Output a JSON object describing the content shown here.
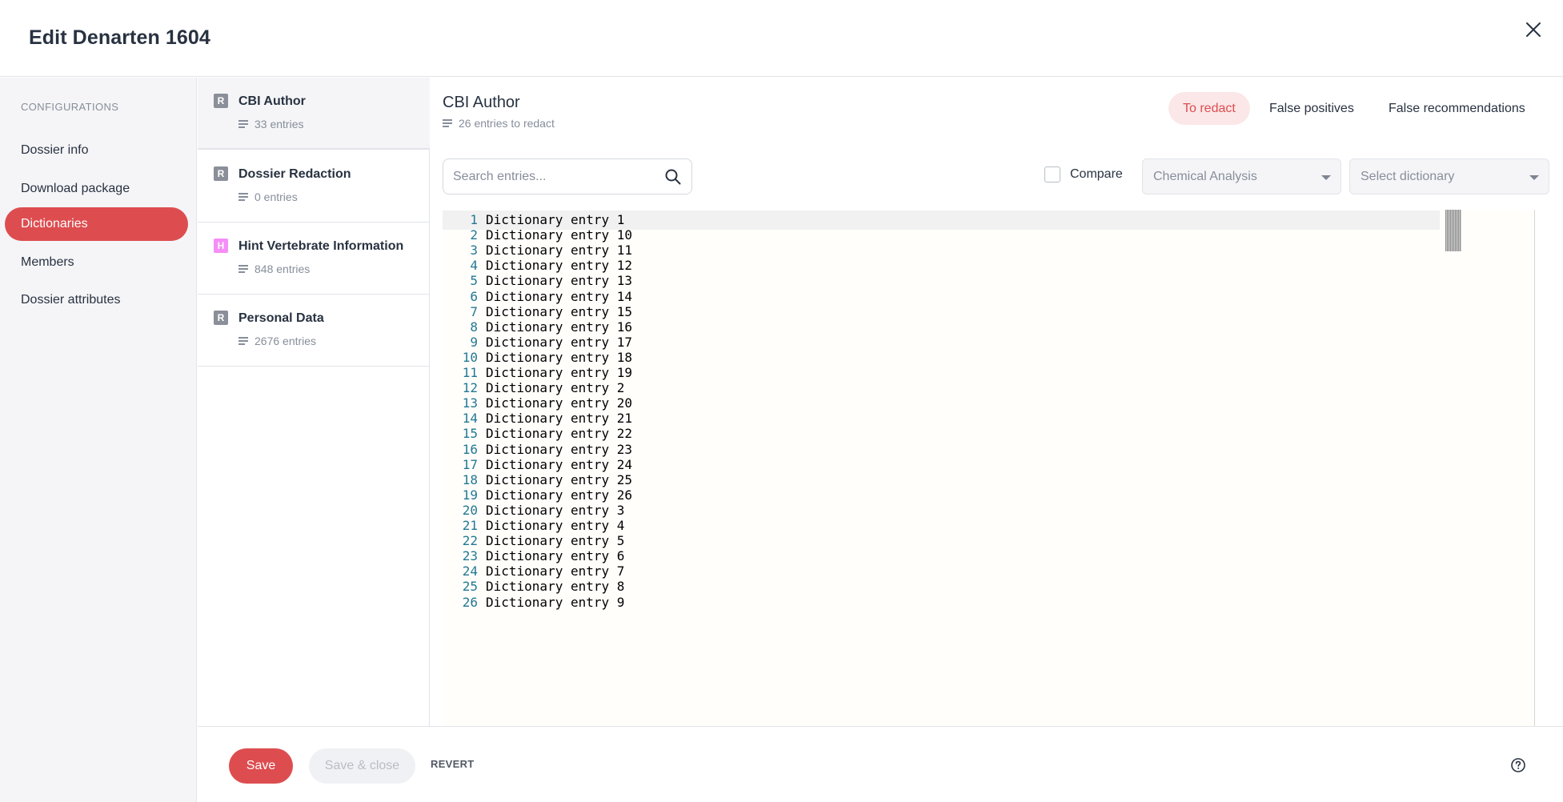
{
  "header": {
    "title": "Edit Denarten 1604"
  },
  "nav": {
    "section_label": "CONFIGURATIONS",
    "items": [
      {
        "label": "Dossier info",
        "active": false
      },
      {
        "label": "Download package",
        "active": false
      },
      {
        "label": "Dictionaries",
        "active": true
      },
      {
        "label": "Members",
        "active": false
      },
      {
        "label": "Dossier attributes",
        "active": false
      }
    ]
  },
  "dictionaries": [
    {
      "badge": "R",
      "badge_color": "#8a8f99",
      "name": "CBI Author",
      "count": "33 entries",
      "active": true
    },
    {
      "badge": "R",
      "badge_color": "#8a8f99",
      "name": "Dossier Redaction",
      "count": "0 entries",
      "active": false
    },
    {
      "badge": "H",
      "badge_color": "#f58ef7",
      "name": "Hint Vertebrate Information",
      "count": "848 entries",
      "active": false
    },
    {
      "badge": "R",
      "badge_color": "#8a8f99",
      "name": "Personal Data",
      "count": "2676 entries",
      "active": false
    }
  ],
  "main": {
    "title": "CBI Author",
    "subtitle": "26 entries to redact",
    "tabs": [
      {
        "label": "To redact",
        "active": true
      },
      {
        "label": "False positives",
        "active": false
      },
      {
        "label": "False recommendations",
        "active": false
      }
    ],
    "search": {
      "placeholder": "Search entries...",
      "value": ""
    },
    "compare_label": "Compare",
    "compare_checked": false,
    "compare_select": {
      "value": "Chemical Analysis"
    },
    "dictionary_select": {
      "placeholder": "Select dictionary"
    }
  },
  "editor": {
    "lines": [
      "Dictionary entry 1",
      "Dictionary entry 10",
      "Dictionary entry 11",
      "Dictionary entry 12",
      "Dictionary entry 13",
      "Dictionary entry 14",
      "Dictionary entry 15",
      "Dictionary entry 16",
      "Dictionary entry 17",
      "Dictionary entry 18",
      "Dictionary entry 19",
      "Dictionary entry 2",
      "Dictionary entry 20",
      "Dictionary entry 21",
      "Dictionary entry 22",
      "Dictionary entry 23",
      "Dictionary entry 24",
      "Dictionary entry 25",
      "Dictionary entry 26",
      "Dictionary entry 3",
      "Dictionary entry 4",
      "Dictionary entry 5",
      "Dictionary entry 6",
      "Dictionary entry 7",
      "Dictionary entry 8",
      "Dictionary entry 9"
    ]
  },
  "footer": {
    "save_label": "Save",
    "save_close_label": "Save & close",
    "revert_label": "REVERT"
  },
  "colors": {
    "accent": "#dd4d50",
    "accent_light": "#fbe7e8",
    "text": "#283241",
    "muted": "#868e9b",
    "line_number": "#237893"
  },
  "icons": {
    "close": "close-icon",
    "search": "search-icon",
    "entries": "lines-icon",
    "help": "help-icon",
    "dropdown": "chevron-down-icon"
  }
}
